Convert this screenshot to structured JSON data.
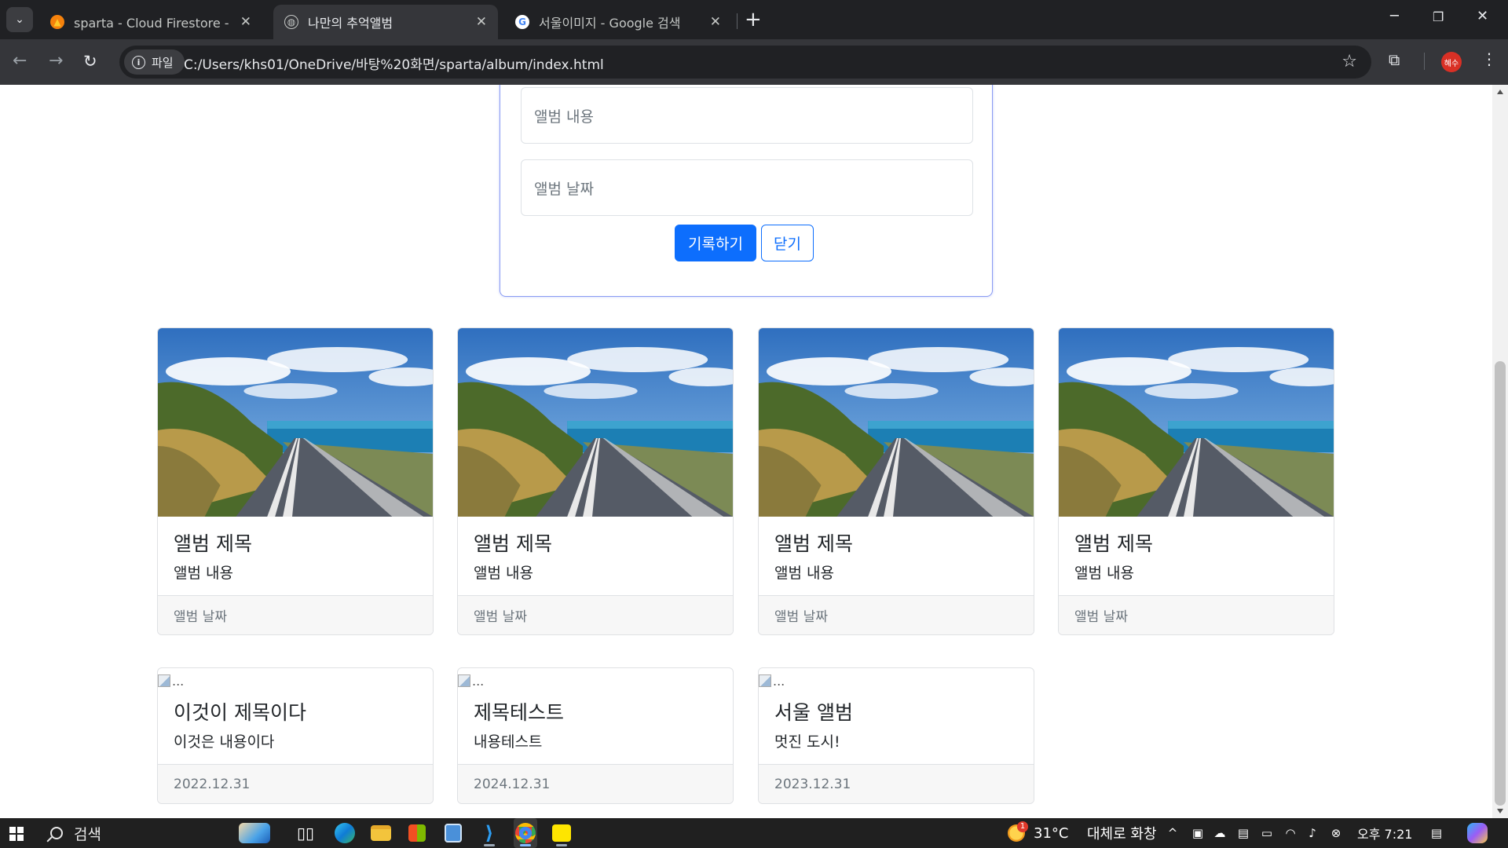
{
  "browser": {
    "tabs": [
      {
        "title": "sparta - Cloud Firestore - 데이",
        "close": "✕",
        "icon": "firebase-icon",
        "active": false
      },
      {
        "title": "나만의 추억앨범",
        "close": "✕",
        "icon": "globe-icon",
        "active": true
      },
      {
        "title": "서울이미지 - Google 검색",
        "close": "✕",
        "icon": "google-icon",
        "active": false
      }
    ],
    "new_tab": "+",
    "site_chip": "파일",
    "url": "C:/Users/khs01/OneDrive/바탕%20화면/sparta/album/index.html",
    "profile_initials": "혜수"
  },
  "form": {
    "content_placeholder": "앨범 내용",
    "date_placeholder": "앨범 날짜",
    "submit_label": "기록하기",
    "close_label": "닫기"
  },
  "cards": [
    {
      "title": "앨범 제목",
      "text": "앨범 내용",
      "date": "앨범 날짜",
      "image": "photo"
    },
    {
      "title": "앨범 제목",
      "text": "앨범 내용",
      "date": "앨범 날짜",
      "image": "photo"
    },
    {
      "title": "앨범 제목",
      "text": "앨범 내용",
      "date": "앨범 날짜",
      "image": "photo"
    },
    {
      "title": "앨범 제목",
      "text": "앨범 내용",
      "date": "앨범 날짜",
      "image": "photo"
    },
    {
      "title": "이것이 제목이다",
      "text": "이것은 내용이다",
      "date": "2022.12.31",
      "image": "broken",
      "alt": "..."
    },
    {
      "title": "제목테스트",
      "text": "내용테스트",
      "date": "2024.12.31",
      "image": "broken",
      "alt": "..."
    },
    {
      "title": "서울 앨범",
      "text": "멋진 도시!",
      "date": "2023.12.31",
      "image": "broken",
      "alt": "..."
    }
  ],
  "taskbar": {
    "search_label": "검색",
    "weather_temp": "31°C",
    "weather_desc": "대체로 화창",
    "weather_badge": "1",
    "time": "오후 7:21"
  },
  "colors": {
    "primary": "#0d6efd",
    "form_border": "#8a9cf2",
    "chrome_dark": "#202124",
    "chrome_toolbar": "#35363a"
  }
}
